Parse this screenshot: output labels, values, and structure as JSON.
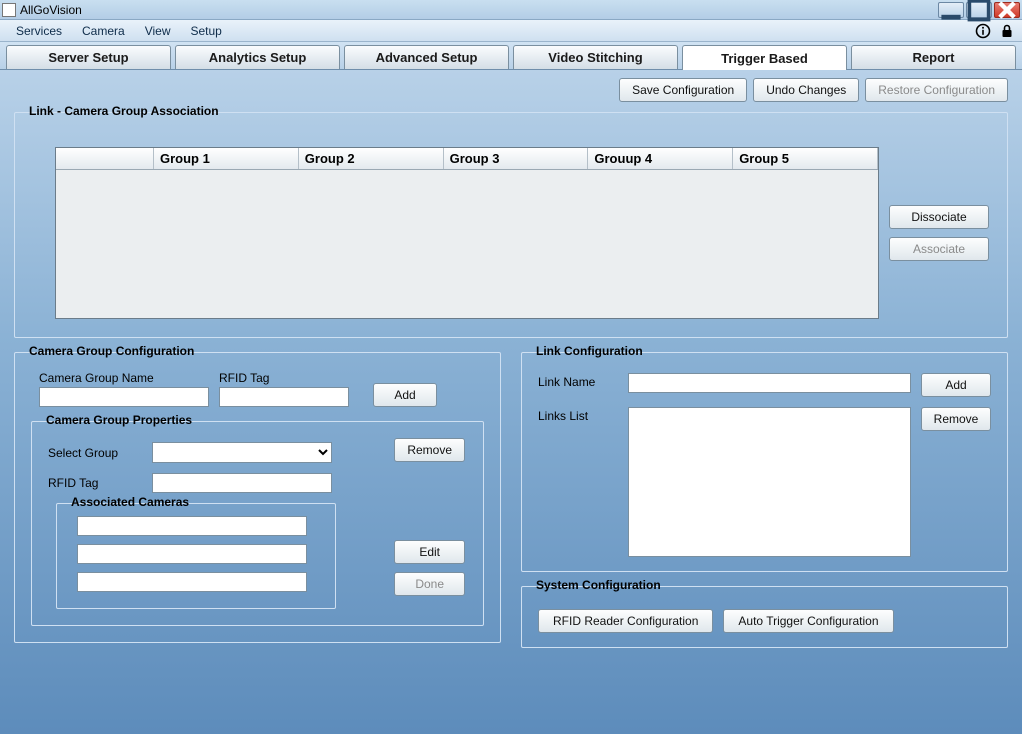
{
  "window": {
    "title": "AllGoVision"
  },
  "menu": {
    "items": [
      "Services",
      "Camera",
      "View",
      "Setup"
    ]
  },
  "tabs": [
    "Server Setup",
    "Analytics Setup",
    "Advanced Setup",
    "Video Stitching",
    "Trigger Based",
    "Report"
  ],
  "active_tab": "Trigger Based",
  "top_buttons": {
    "save": "Save Configuration",
    "undo": "Undo Changes",
    "restore": "Restore Configuration"
  },
  "assoc": {
    "title": "Link - Camera Group Association",
    "columns": [
      "Group 1",
      "Group 2",
      "Group 3",
      "Grouup 4",
      "Group 5"
    ],
    "dissociate": "Dissociate",
    "associate": "Associate"
  },
  "cgconf": {
    "title": "Camera Group Configuration",
    "name_label": "Camera Group Name",
    "rfid_label": "RFID Tag",
    "name_value": "",
    "rfid_value": "",
    "add": "Add",
    "props": {
      "title": "Camera Group Properties",
      "select_group_label": "Select Group",
      "select_group_value": "",
      "rfid_label": "RFID Tag",
      "rfid_value": "",
      "remove": "Remove",
      "edit": "Edit",
      "done": "Done",
      "assoc_cams_title": "Associated Cameras"
    }
  },
  "linkconf": {
    "title": "Link Configuration",
    "name_label": "Link Name",
    "name_value": "",
    "list_label": "Links List",
    "add": "Add",
    "remove": "Remove"
  },
  "sysconf": {
    "title": "System Configuration",
    "rfid_btn": "RFID Reader Configuration",
    "auto_btn": "Auto Trigger Configuration"
  }
}
